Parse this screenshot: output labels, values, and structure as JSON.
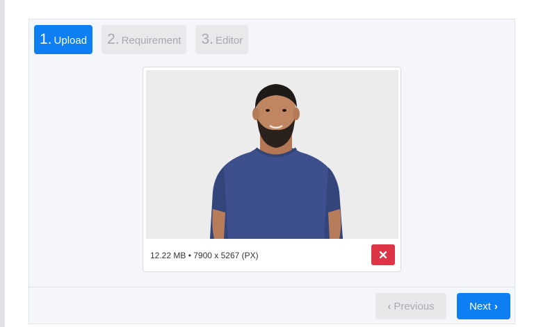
{
  "steps": [
    {
      "number": "1.",
      "label": "Upload",
      "state": "active"
    },
    {
      "number": "2.",
      "label": "Requirement",
      "state": "inactive"
    },
    {
      "number": "3.",
      "label": "Editor",
      "state": "inactive"
    }
  ],
  "upload": {
    "file_info": "12.22 MB • 7900 x 5267 (PX)",
    "remove_icon": "close-icon"
  },
  "footer": {
    "previous_label": "Previous",
    "next_label": "Next",
    "previous_icon": "chevron-left-icon",
    "next_icon": "chevron-right-icon"
  },
  "colors": {
    "primary": "#0d7ff2",
    "danger": "#dc3545",
    "inactive_bg": "#e8e9eb",
    "panel_bg": "#f4f6f9"
  }
}
